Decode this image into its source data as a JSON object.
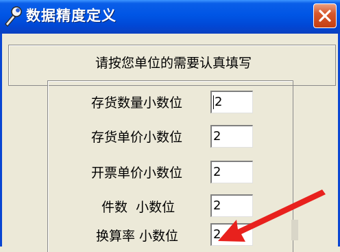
{
  "window": {
    "title": "数据精度定义",
    "close_icon": "close-icon",
    "title_icon": "wrench-icon"
  },
  "instruction": "请按您单位的需要认真填写",
  "fields": [
    {
      "label": "存货数量小数位",
      "value": "2"
    },
    {
      "label": "存货单价小数位",
      "value": "2"
    },
    {
      "label": "开票单价小数位",
      "value": "2"
    },
    {
      "label": "件数  小数位",
      "value": "2"
    },
    {
      "label": "换算率 小数位",
      "value": "2"
    }
  ],
  "annotation": {
    "icon": "red-arrow-icon",
    "color": "#e8211d"
  },
  "colors": {
    "titlebar": "#0055e5",
    "dialog_bg": "#ece9d8",
    "close_button": "#d8582d"
  }
}
